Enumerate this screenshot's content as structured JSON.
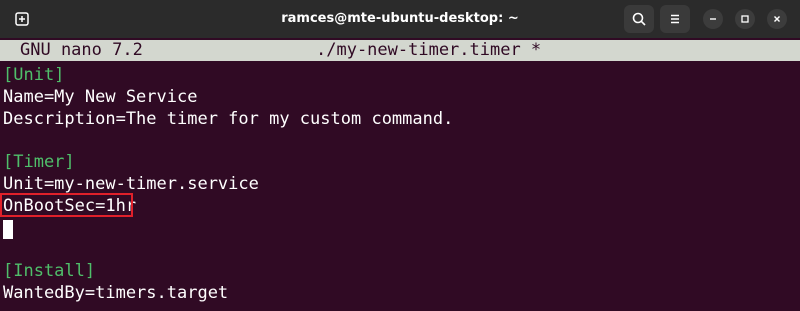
{
  "window": {
    "title": "ramces@mte-ubuntu-desktop: ~"
  },
  "titlebar": {
    "icons": {
      "new_tab": "new-tab-icon",
      "search": "search-icon",
      "menu": "hamburger-menu-icon",
      "minimize": "minimize-icon",
      "maximize": "maximize-icon",
      "close": "close-icon"
    }
  },
  "nano": {
    "version": "GNU nano 7.2",
    "filename": "./my-new-timer.timer *"
  },
  "editor": {
    "lines": {
      "unit_header": "[Unit]",
      "name": "Name=My New Service",
      "description": "Description=The timer for my custom command.",
      "timer_header": "[Timer]",
      "unit": "Unit=my-new-timer.service",
      "onbootsec": "OnBootSec=1hr",
      "install_header": "[Install]",
      "wantedby": "WantedBy=timers.target"
    }
  },
  "colors": {
    "terminal_bg": "#300a24",
    "section_header": "#4fbf6a",
    "highlight_border": "#e0202a",
    "titlebar_bg": "#2b2b2b"
  }
}
